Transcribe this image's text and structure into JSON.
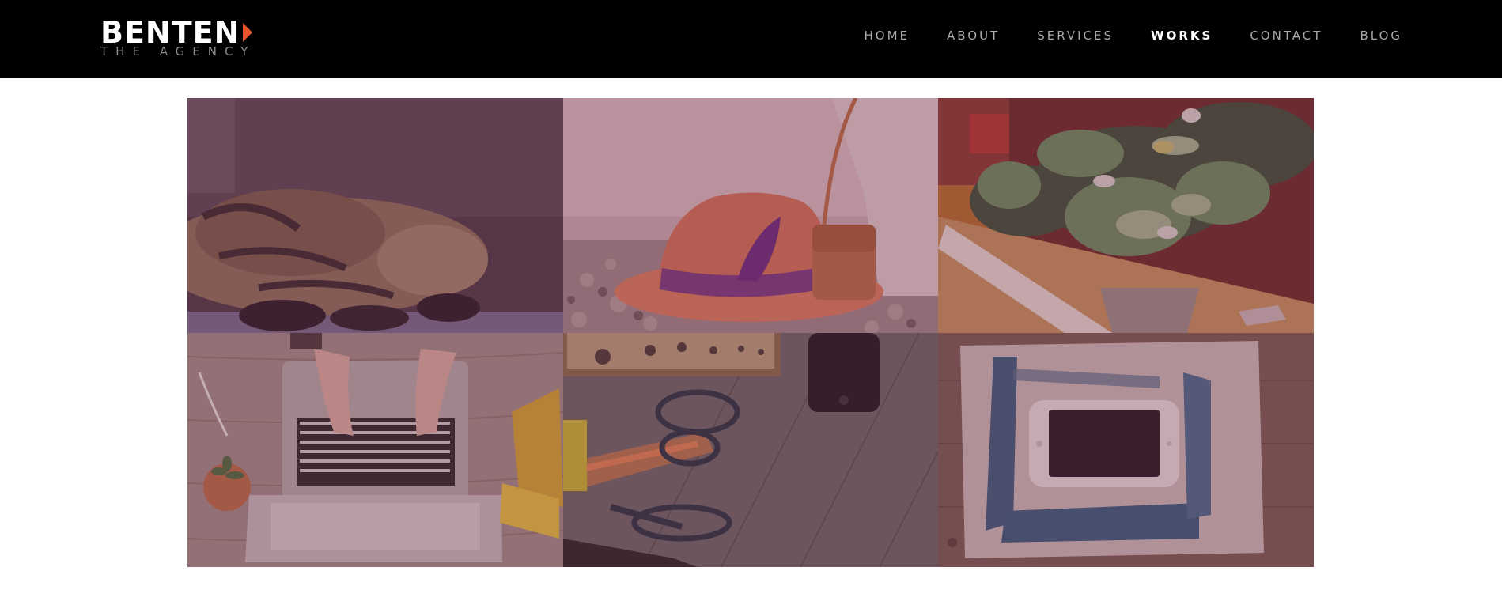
{
  "header": {
    "logo": {
      "name": "BENTEN",
      "tagline": "THE AGENCY"
    },
    "menu": [
      {
        "label": "HOME",
        "active": false
      },
      {
        "label": "ABOUT",
        "active": false
      },
      {
        "label": "SERVICES",
        "active": false
      },
      {
        "label": "WORKS",
        "active": true
      },
      {
        "label": "CONTACT",
        "active": false
      },
      {
        "label": "BLOG",
        "active": false
      }
    ]
  },
  "colors": {
    "navbar": "#000000",
    "accent": "#e8542c",
    "menu_active": "#ffffff",
    "menu_inactive": "#a9a9a9",
    "overlay_tint": "#6e2d50"
  },
  "works": [
    {
      "subject": "sleeping-cat"
    },
    {
      "subject": "orange-hat-and-bag"
    },
    {
      "subject": "potted-plants"
    },
    {
      "subject": "laptop-typing"
    },
    {
      "subject": "tools-and-phone"
    },
    {
      "subject": "phone-on-painted-paper"
    }
  ]
}
